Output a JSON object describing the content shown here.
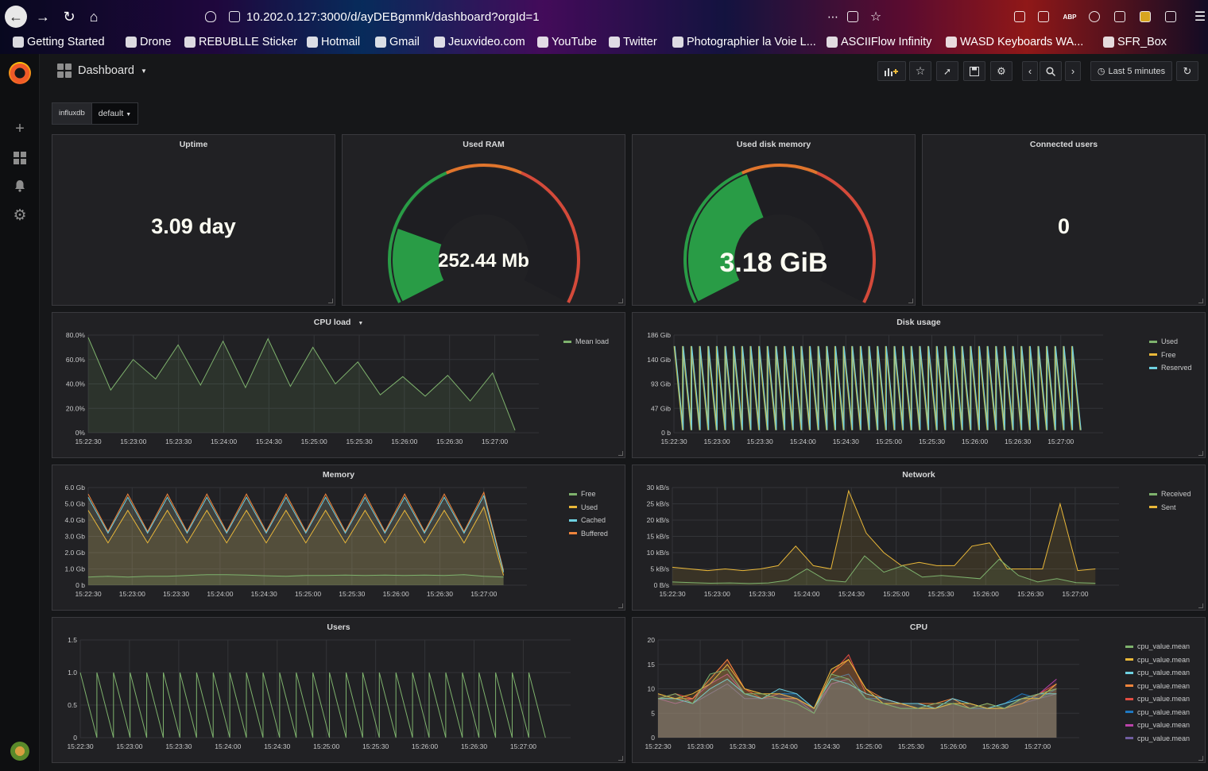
{
  "browser": {
    "url": "10.202.0.127:3000/d/ayDEBgmmk/dashboard?orgId=1",
    "bookmarks": [
      "Getting Started",
      "Drone",
      "REBUBLLE Sticker",
      "Hotmail",
      "Gmail",
      "Jeuxvideo.com",
      "YouTube",
      "Twitter",
      "Photographier la Voie L...",
      "ASCIIFlow Infinity",
      "WASD Keyboards WA...",
      "SFR_Box"
    ],
    "abp_label": "ABP"
  },
  "sidebar": {
    "items": [
      {
        "icon": "plus-icon"
      },
      {
        "icon": "dashboards-icon"
      },
      {
        "icon": "bell-icon"
      },
      {
        "icon": "gear-icon"
      }
    ]
  },
  "topbar": {
    "title": "Dashboard",
    "time_range": "Last 5 minutes"
  },
  "variables": {
    "label": "influxdb",
    "value": "default"
  },
  "colors": {
    "green": "#299c46",
    "orange": "#e0752d",
    "red": "#d44a3a",
    "greenline": "#7eb26d",
    "yellow": "#eab839",
    "blue": "#6ed0e0"
  },
  "panels": {
    "uptime": {
      "title": "Uptime",
      "value": "3.09 day"
    },
    "used_ram": {
      "title": "Used RAM",
      "value": "252.44 Mb",
      "fraction": 0.2
    },
    "used_disk": {
      "title": "Used disk memory",
      "value": "3.18 GiB",
      "fraction": 0.41
    },
    "connected_users": {
      "title": "Connected users",
      "value": "0"
    },
    "cpu_load": {
      "title": "CPU load"
    },
    "disk_usage": {
      "title": "Disk usage"
    },
    "memory": {
      "title": "Memory"
    },
    "network": {
      "title": "Network"
    },
    "users": {
      "title": "Users"
    },
    "cpu": {
      "title": "CPU"
    }
  },
  "time_ticks": [
    "15:22:30",
    "15:23:00",
    "15:23:30",
    "15:24:00",
    "15:24:30",
    "15:25:00",
    "15:25:30",
    "15:26:00",
    "15:26:30",
    "15:27:00"
  ],
  "chart_data": [
    {
      "id": "cpu_load",
      "type": "area",
      "title": "CPU load",
      "y_ticks": [
        "80.0%",
        "60.0%",
        "40.0%",
        "20.0%",
        "0%"
      ],
      "ylim": [
        0,
        80
      ],
      "series": [
        {
          "name": "Mean load",
          "color": "#7eb26d",
          "values": [
            78,
            35,
            60,
            44,
            72,
            39,
            75,
            37,
            77,
            38,
            70,
            40,
            58,
            31,
            46,
            30,
            47,
            26,
            49,
            2
          ]
        }
      ]
    },
    {
      "id": "disk_usage",
      "type": "line",
      "title": "Disk usage",
      "y_ticks": [
        "186 Gib",
        "140 Gib",
        "93 Gib",
        "47 Gib",
        "0 b"
      ],
      "ylim": [
        0,
        186
      ],
      "series": [
        {
          "name": "Used",
          "color": "#7eb26d"
        },
        {
          "name": "Free",
          "color": "#eab839"
        },
        {
          "name": "Reserved",
          "color": "#6ed0e0"
        }
      ],
      "sawtooth": {
        "count": 48,
        "high": 165,
        "low": 5
      }
    },
    {
      "id": "memory",
      "type": "area",
      "title": "Memory",
      "y_ticks": [
        "6.0 Gb",
        "5.0 Gb",
        "4.0 Gb",
        "3.0 Gb",
        "2.0 Gb",
        "1.0 Gb",
        "0 b"
      ],
      "ylim": [
        0,
        6
      ],
      "series": [
        {
          "name": "Free",
          "color": "#7eb26d",
          "values": [
            0.5,
            0.55,
            0.5,
            0.55,
            0.55,
            0.6,
            0.65,
            0.65,
            0.62,
            0.58,
            0.55,
            0.6,
            0.6,
            0.62,
            0.6,
            0.62,
            0.6,
            0.62,
            0.6,
            0.65,
            0.55,
            0.5
          ]
        },
        {
          "name": "Used",
          "color": "#eab839",
          "values": [
            4.6,
            2.6,
            4.6,
            2.6,
            4.6,
            2.6,
            4.6,
            2.6,
            4.6,
            2.6,
            4.6,
            2.6,
            4.6,
            2.6,
            4.6,
            2.6,
            4.6,
            2.6,
            4.6,
            2.6,
            4.8,
            0.6
          ]
        },
        {
          "name": "Cached",
          "color": "#6ed0e0",
          "values": [
            5.4,
            3.2,
            5.4,
            3.2,
            5.4,
            3.2,
            5.4,
            3.2,
            5.4,
            3.2,
            5.4,
            3.2,
            5.4,
            3.2,
            5.4,
            3.2,
            5.4,
            3.2,
            5.4,
            3.2,
            5.5,
            0.8
          ]
        },
        {
          "name": "Buffered",
          "color": "#ef843c",
          "values": [
            5.6,
            3.3,
            5.6,
            3.3,
            5.6,
            3.3,
            5.6,
            3.3,
            5.6,
            3.3,
            5.6,
            3.3,
            5.6,
            3.3,
            5.6,
            3.3,
            5.6,
            3.3,
            5.6,
            3.3,
            5.7,
            0.9
          ]
        }
      ]
    },
    {
      "id": "network",
      "type": "area",
      "title": "Network",
      "y_ticks": [
        "30 kB/s",
        "25 kB/s",
        "20 kB/s",
        "15 kB/s",
        "10 kB/s",
        "5 kB/s",
        "0 B/s"
      ],
      "ylim": [
        0,
        30
      ],
      "series": [
        {
          "name": "Received",
          "color": "#7eb26d",
          "values": [
            1,
            0.8,
            0.6,
            0.7,
            0.5,
            0.7,
            1.5,
            5,
            1.5,
            1,
            9,
            4,
            6,
            2.5,
            3,
            2.5,
            2,
            8,
            3,
            1,
            2,
            0.8,
            0.6
          ]
        },
        {
          "name": "Sent",
          "color": "#eab839",
          "values": [
            5.5,
            5,
            4.5,
            5,
            4.5,
            5,
            6,
            12,
            6,
            5,
            29,
            16,
            10,
            6,
            7,
            6,
            6,
            12,
            13,
            5,
            5,
            5,
            25,
            4.5,
            5
          ]
        }
      ]
    },
    {
      "id": "users",
      "type": "line",
      "title": "Users",
      "y_ticks": [
        "1.5",
        "1.0",
        "0.5",
        "0"
      ],
      "ylim": [
        0,
        1.5
      ],
      "series": [
        {
          "name": "users",
          "color": "#7eb26d"
        }
      ],
      "sawtooth": {
        "count": 28,
        "high": 1,
        "low": 0
      }
    },
    {
      "id": "cpu",
      "type": "area",
      "title": "CPU",
      "y_ticks": [
        "20",
        "15",
        "10",
        "5",
        "0"
      ],
      "ylim": [
        0,
        20
      ],
      "series": [
        {
          "name": "cpu_value.mean",
          "color": "#7eb26d",
          "values": [
            8,
            9,
            7,
            13,
            14,
            9,
            9,
            8,
            7,
            5,
            13,
            12,
            8,
            7,
            6,
            6,
            7,
            7,
            6,
            7,
            6,
            8,
            9,
            10
          ]
        },
        {
          "name": "cpu_value.mean",
          "color": "#eab839",
          "values": [
            9,
            8,
            9,
            11,
            15,
            10,
            9,
            9,
            8,
            6,
            14,
            16,
            10,
            7,
            7,
            6,
            6,
            7,
            7,
            6,
            6,
            8,
            8,
            11
          ]
        },
        {
          "name": "cpu_value.mean",
          "color": "#6ed0e0",
          "values": [
            8,
            8,
            7,
            10,
            12,
            9,
            8,
            10,
            9,
            6,
            12,
            11,
            9,
            8,
            7,
            7,
            6,
            8,
            7,
            6,
            7,
            8,
            9,
            9
          ]
        },
        {
          "name": "cpu_value.mean",
          "color": "#ef843c",
          "values": [
            9,
            8,
            8,
            12,
            16,
            10,
            9,
            8,
            8,
            6,
            13,
            16,
            10,
            8,
            7,
            7,
            7,
            8,
            6,
            7,
            6,
            7,
            9,
            10
          ]
        },
        {
          "name": "cpu_value.mean",
          "color": "#e24d42",
          "values": [
            8,
            9,
            8,
            12,
            16,
            10,
            8,
            9,
            8,
            6,
            13,
            17,
            9,
            8,
            7,
            6,
            7,
            7,
            7,
            6,
            6,
            8,
            9,
            11
          ]
        },
        {
          "name": "cpu_value.mean",
          "color": "#1f78c1",
          "values": [
            9,
            8,
            7,
            10,
            12,
            9,
            8,
            9,
            9,
            6,
            12,
            13,
            8,
            8,
            7,
            7,
            6,
            7,
            6,
            6,
            7,
            9,
            8,
            10
          ]
        },
        {
          "name": "cpu_value.mean",
          "color": "#ba43a9",
          "values": [
            8,
            7,
            8,
            11,
            13,
            9,
            8,
            9,
            8,
            6,
            11,
            12,
            8,
            7,
            7,
            6,
            6,
            7,
            6,
            6,
            6,
            8,
            9,
            12
          ]
        },
        {
          "name": "cpu_value.mean",
          "color": "#705da0",
          "values": [
            8,
            8,
            7,
            9,
            11,
            8,
            8,
            8,
            8,
            5,
            11,
            12,
            8,
            7,
            6,
            6,
            6,
            7,
            6,
            6,
            6,
            7,
            8,
            9
          ]
        }
      ]
    }
  ]
}
